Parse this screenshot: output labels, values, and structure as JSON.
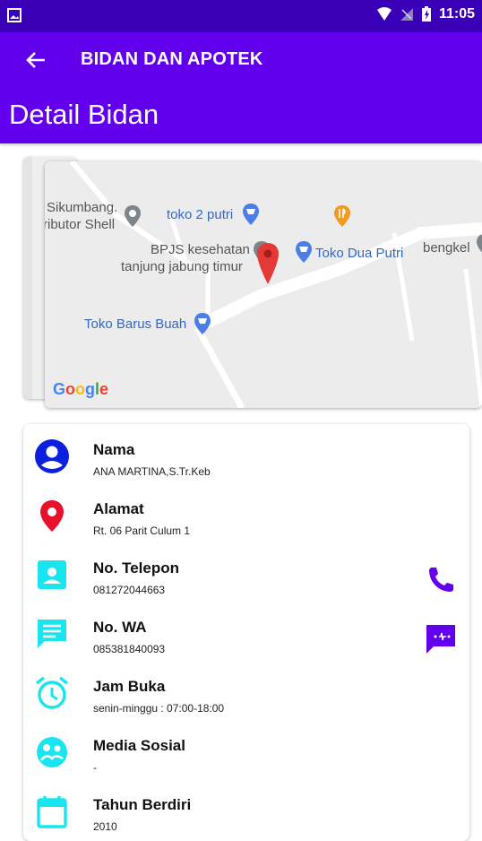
{
  "status_bar": {
    "time": "11:05"
  },
  "app_bar": {
    "title": "BIDAN DAN APOTEK"
  },
  "header": {
    "title": "Detail Bidan"
  },
  "map": {
    "labels": {
      "sikumbang_1": "Sikumbang.",
      "sikumbang_2": "ributor Shell",
      "toko2putri": "toko 2 putri",
      "bpjs_1": "BPJS kesehatan",
      "bpjs_2": "tanjung jabung timur",
      "toko_dua_putri": "Toko Dua Putri",
      "bengkel": "bengkel",
      "toko_barus": "Toko Barus Buah"
    },
    "google": [
      "G",
      "o",
      "o",
      "g",
      "l",
      "e"
    ]
  },
  "details": [
    {
      "label": "Nama",
      "value": "ANA MARTINA,S.Tr.Keb",
      "icon": "account-circle-icon"
    },
    {
      "label": "Alamat",
      "value": "Rt. 06 Parit Culum 1",
      "icon": "location-pin-icon"
    },
    {
      "label": "No. Telepon",
      "value": "081272044663",
      "icon": "contact-card-icon"
    },
    {
      "label": "No. WA",
      "value": "085381840093",
      "icon": "message-icon"
    },
    {
      "label": "Jam Buka",
      "value": "senin-minggu : 07:00-18:00",
      "icon": "alarm-icon"
    },
    {
      "label": "Media Sosial",
      "value": "-",
      "icon": "social-icon"
    },
    {
      "label": "Tahun Berdiri",
      "value": "2010",
      "icon": "calendar-icon"
    }
  ],
  "colors": {
    "primary": "#6200ee",
    "status": "#3a00b8",
    "accent_cyan": "#19e5f0",
    "blue": "#0a1fe0",
    "red": "#e8102b",
    "purple": "#6200ee"
  }
}
